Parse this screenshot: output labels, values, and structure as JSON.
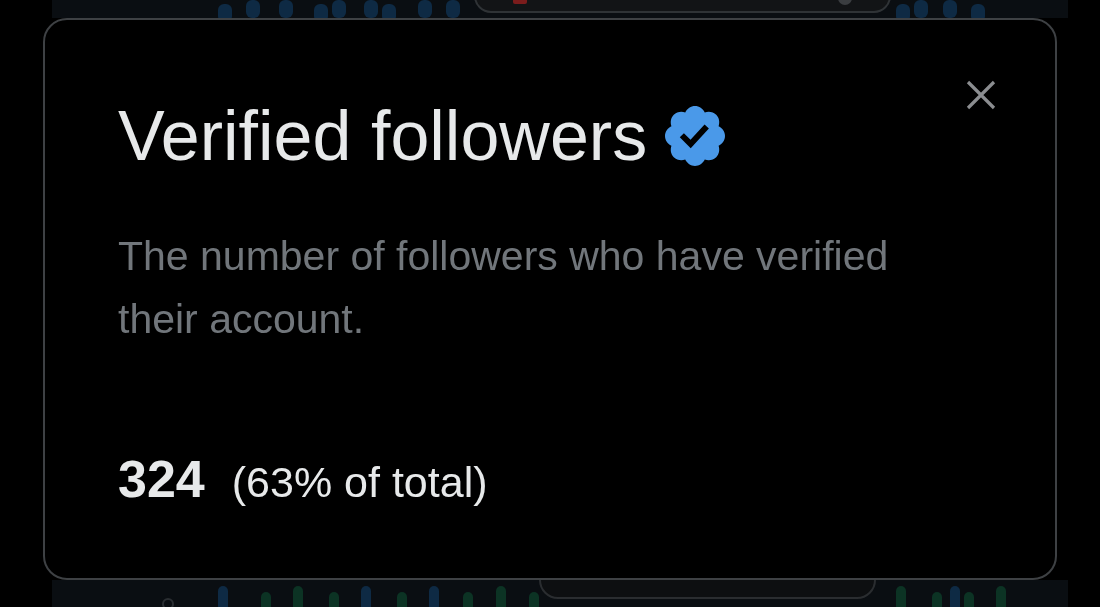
{
  "dialog": {
    "title": "Verified followers",
    "verified_badge": true,
    "description": "The number of followers who have verified their account.",
    "value": "324",
    "share": "(63% of total)"
  }
}
